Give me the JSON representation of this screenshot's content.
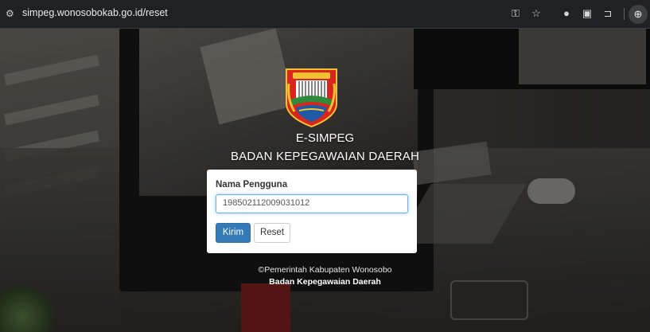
{
  "browser": {
    "url": "simpeg.wonosobokab.go.id/reset",
    "icons": [
      "site-settings-icon",
      "password-key-icon",
      "star-icon",
      "extension-icon",
      "image-icon",
      "puzzle-icon",
      "extensions-menu-icon"
    ]
  },
  "header": {
    "app_name": "E-SIMPEG",
    "agency": "BADAN KEPEGAWAIAN DAERAH"
  },
  "form": {
    "username_label": "Nama Pengguna",
    "username_value": "198502112009031012",
    "submit_label": "Kirim",
    "reset_label": "Reset"
  },
  "footer": {
    "copyright": "©Pemerintah Kabupaten Wonosobo",
    "agency": "Badan Kepegawaian Daerah"
  },
  "colors": {
    "primary_button": "#337ab7",
    "input_focus": "#66afe9",
    "chrome_bg": "#202124"
  }
}
